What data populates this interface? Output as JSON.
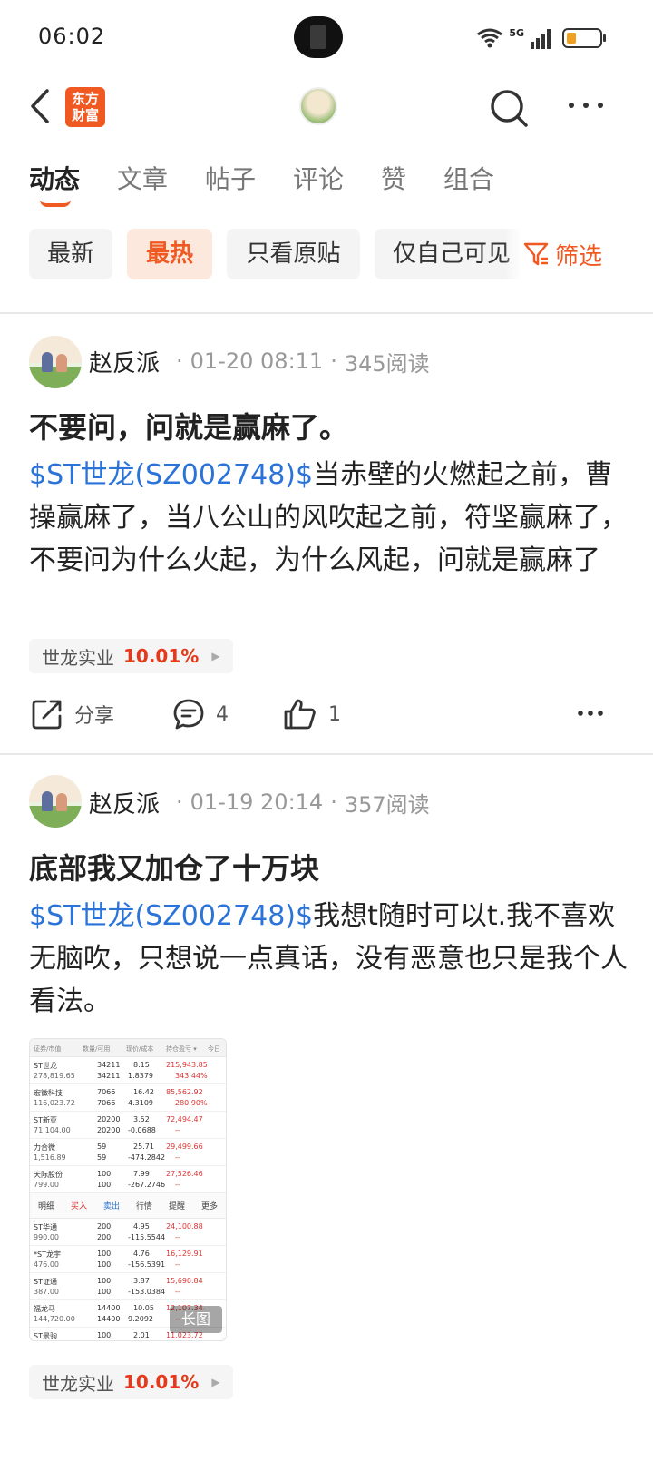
{
  "status_bar": {
    "time": "06:02",
    "network": "5G"
  },
  "nav": {
    "logo_text_line1": "东方",
    "logo_text_line2": "财富",
    "accent_color": "#f05a22"
  },
  "tabs": [
    {
      "label": "动态",
      "active": true
    },
    {
      "label": "文章",
      "active": false
    },
    {
      "label": "帖子",
      "active": false
    },
    {
      "label": "评论",
      "active": false
    },
    {
      "label": "赞",
      "active": false
    },
    {
      "label": "组合",
      "active": false
    }
  ],
  "filters": {
    "chips": [
      {
        "label": "最新",
        "selected": false
      },
      {
        "label": "最热",
        "selected": true
      },
      {
        "label": "只看原贴",
        "selected": false
      },
      {
        "label": "仅自己可见",
        "selected": false
      }
    ],
    "filter_label": "筛选"
  },
  "posts": [
    {
      "author": "赵反派",
      "time": "01-20 08:11",
      "reads": "345阅读",
      "title": "不要问，问就是赢麻了。",
      "tag": "$ST世龙(SZ002748)$",
      "text": "当赤壁的火燃起之前，曹操赢麻了，当八公山的风吹起之前，符坚赢麻了，不要问为什么火起，为什么风起，问就是赢麻了",
      "stock_name": "世龙实业",
      "stock_change": "10.01%",
      "share_label": "分享",
      "comments": "4",
      "likes": "1"
    },
    {
      "author": "赵反派",
      "time": "01-19 20:14",
      "reads": "357阅读",
      "title": "底部我又加仓了十万块",
      "tag": "$ST世龙(SZ002748)$",
      "text": "我想t随时可以t.我不喜欢无脑吹，只想说一点真话，没有恶意也只是我个人看法。",
      "image_badge": "长图",
      "stock_name": "世龙实业",
      "stock_change": "10.01%"
    }
  ],
  "holdings_image": {
    "headers": [
      "证券/市值",
      "数量/可用",
      "现价/成本",
      "持仓盈亏 ▾",
      "今日"
    ],
    "rows_top": [
      {
        "name": "ST世龙",
        "value": "278,819.65",
        "qty": "34211",
        "avail": "34211",
        "price": "8.15",
        "cost": "1.8379",
        "pl": "215,943.85",
        "plpct": "343.44%"
      },
      {
        "name": "宏微科技",
        "value": "116,023.72",
        "qty": "7066",
        "avail": "7066",
        "price": "16.42",
        "cost": "4.3109",
        "pl": "85,562.92",
        "plpct": "280.90%"
      },
      {
        "name": "ST新亚",
        "value": "71,104.00",
        "qty": "20200",
        "avail": "20200",
        "price": "3.52",
        "cost": "-0.0688",
        "pl": "72,494.47",
        "plpct": "--"
      },
      {
        "name": "力合微",
        "value": "1,516.89",
        "qty": "59",
        "avail": "59",
        "price": "25.71",
        "cost": "-474.2842",
        "pl": "29,499.66",
        "plpct": "--"
      },
      {
        "name": "天际股份",
        "value": "799.00",
        "qty": "100",
        "avail": "100",
        "price": "7.99",
        "cost": "-267.2746",
        "pl": "27,526.46",
        "plpct": "--"
      }
    ],
    "menu": [
      "明细",
      "买入",
      "卖出",
      "行情",
      "提醒",
      "更多"
    ],
    "rows_bottom": [
      {
        "name": "ST华通",
        "value": "990.00",
        "qty": "200",
        "avail": "200",
        "price": "4.95",
        "cost": "-115.5544",
        "pl": "24,100.88",
        "plpct": "--"
      },
      {
        "name": "*ST龙宇",
        "value": "476.00",
        "qty": "100",
        "avail": "100",
        "price": "4.76",
        "cost": "-156.5391",
        "pl": "16,129.91",
        "plpct": "--"
      },
      {
        "name": "ST证通",
        "value": "387.00",
        "qty": "100",
        "avail": "100",
        "price": "3.87",
        "cost": "-153.0384",
        "pl": "15,690.84",
        "plpct": "--"
      },
      {
        "name": "福龙马",
        "value": "144,720.00",
        "qty": "14400",
        "avail": "14400",
        "price": "10.05",
        "cost": "9.2092",
        "pl": "12,107.34",
        "plpct": "--"
      },
      {
        "name": "ST景驹",
        "value": "",
        "qty": "100",
        "avail": "",
        "price": "2.01",
        "cost": "",
        "pl": "11,023.72",
        "plpct": ""
      }
    ]
  }
}
